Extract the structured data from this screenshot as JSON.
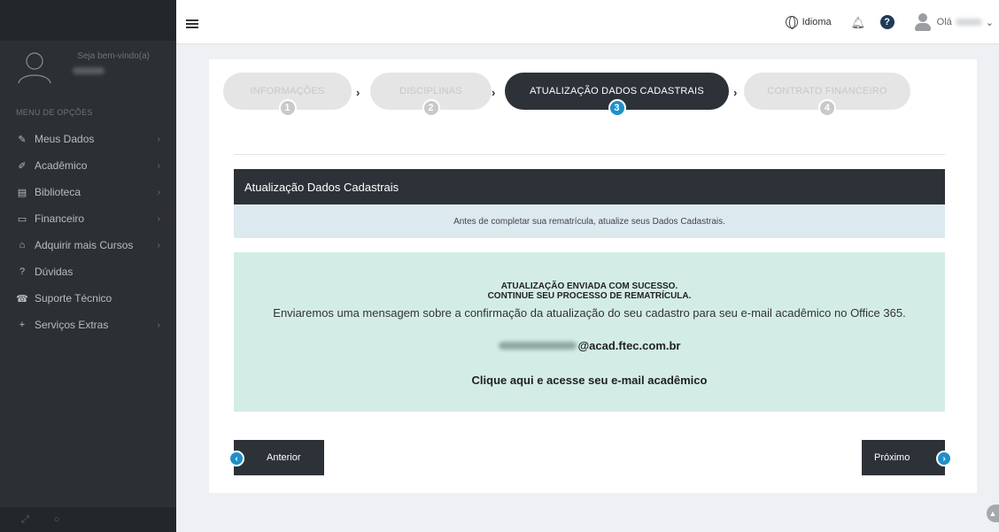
{
  "sidebar": {
    "welcome": "Seja bem-vindo(a)",
    "menu_title": "MENU DE OPÇÕES",
    "items": [
      {
        "label": "Meus Dados",
        "icon": "edit-icon",
        "glyph": "✎",
        "has_arrow": true
      },
      {
        "label": "Acadêmico",
        "icon": "pencil-icon",
        "glyph": "✐",
        "has_arrow": true
      },
      {
        "label": "Biblioteca",
        "icon": "book-icon",
        "glyph": "▤",
        "has_arrow": true
      },
      {
        "label": "Financeiro",
        "icon": "wallet-icon",
        "glyph": "▭",
        "has_arrow": true
      },
      {
        "label": "Adquirir mais Cursos",
        "icon": "home-icon",
        "glyph": "⌂",
        "has_arrow": true
      },
      {
        "label": "Dúvidas",
        "icon": "question-circle-icon",
        "glyph": "?",
        "has_arrow": false
      },
      {
        "label": "Suporte Técnico",
        "icon": "support-icon",
        "glyph": "☎",
        "has_arrow": false
      },
      {
        "label": "Serviços Extras",
        "icon": "user-plus-icon",
        "glyph": "+",
        "has_arrow": true
      }
    ],
    "arrow": "›"
  },
  "header": {
    "language_label": "Idioma",
    "greeting": "Olá",
    "help_glyph": "?"
  },
  "steps": [
    {
      "label": "INFORMAÇÕES",
      "num": "1",
      "active": false
    },
    {
      "label": "DISCIPLINAS",
      "num": "2",
      "active": false
    },
    {
      "label": "ATUALIZAÇÃO DADOS CADASTRAIS",
      "num": "3",
      "active": true
    },
    {
      "label": "CONTRATO FINANCEIRO",
      "num": "4",
      "active": false
    }
  ],
  "section": {
    "title": "Atualização Dados Cadastrais",
    "info": "Antes de completar sua rematrícula, atualize seus Dados Cadastrais."
  },
  "success": {
    "title_line1": "ATUALIZAÇÃO ENVIADA COM SUCESSO.",
    "title_line2": "CONTINUE SEU PROCESSO DE REMATRÍCULA.",
    "message": "Enviaremos uma mensagem sobre a confirmação da atualização do seu cadastro para seu e-mail acadêmico no Office 365.",
    "email_domain": "@acad.ftec.com.br",
    "link_text": "Clique aqui e acesse seu e-mail acadêmico"
  },
  "nav": {
    "prev_label": "Anterior",
    "next_label": "Próximo"
  },
  "colors": {
    "dark": "#2d3238",
    "accent": "#1e90c9",
    "info_bg": "#dceaf0",
    "success_bg": "#d3ede6"
  }
}
